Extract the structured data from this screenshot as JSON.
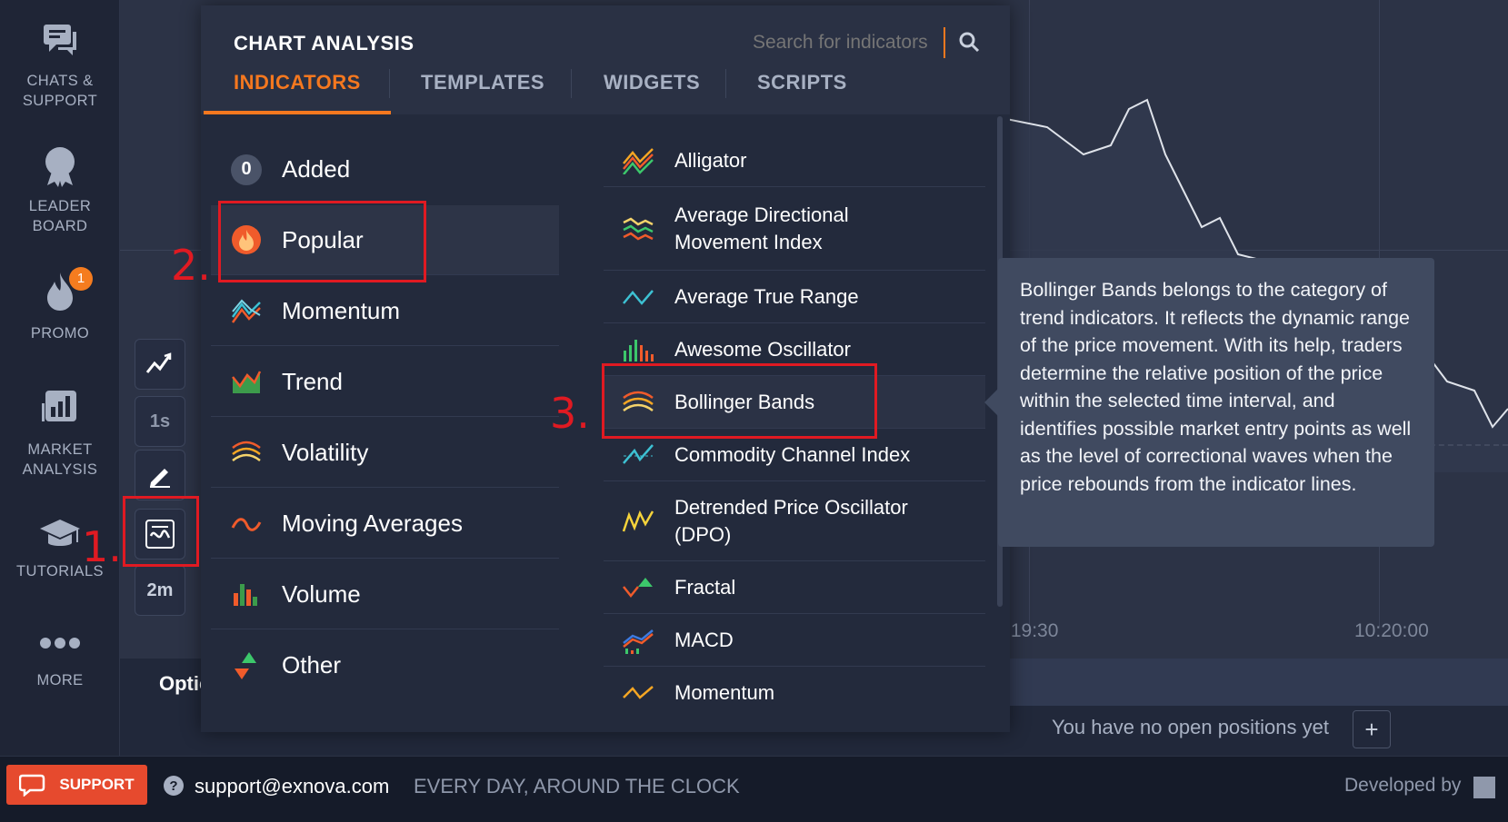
{
  "sidebar": {
    "items": [
      {
        "label": "CHATS &\nSUPPORT",
        "icon": "chat-icon"
      },
      {
        "label": "LEADER\nBOARD",
        "icon": "medal-icon"
      },
      {
        "label": "PROMO",
        "icon": "flame-icon",
        "badge": "1"
      },
      {
        "label": "MARKET\nANALYSIS",
        "icon": "bar-chart-icon"
      },
      {
        "label": "TUTORIALS",
        "icon": "graduation-cap-icon"
      },
      {
        "label": "MORE",
        "icon": "more-dots-icon"
      }
    ]
  },
  "chart": {
    "time_labels": [
      ":19:30",
      "10:20:00"
    ],
    "timeframe": "1s",
    "expiry": "2m",
    "options_tab": "Optic",
    "no_positions": "You have no open positions yet",
    "add_label": "+"
  },
  "annotations": {
    "step1": "1.",
    "step2": "2.",
    "step3": "3."
  },
  "panel": {
    "title": "CHART ANALYSIS",
    "search_placeholder": "Search for indicators",
    "tabs": [
      {
        "label": "INDICATORS",
        "active": true
      },
      {
        "label": "TEMPLATES",
        "active": false
      },
      {
        "label": "WIDGETS",
        "active": false
      },
      {
        "label": "SCRIPTS",
        "active": false
      }
    ],
    "added": {
      "count": "0",
      "label": "Added"
    },
    "categories": [
      {
        "label": "Popular",
        "icon": "fire-icon",
        "active": true
      },
      {
        "label": "Momentum",
        "icon": "momentum-icon"
      },
      {
        "label": "Trend",
        "icon": "trend-icon"
      },
      {
        "label": "Volatility",
        "icon": "volatility-icon"
      },
      {
        "label": "Moving Averages",
        "icon": "moving-average-icon"
      },
      {
        "label": "Volume",
        "icon": "volume-icon"
      },
      {
        "label": "Other",
        "icon": "other-arrows-icon"
      }
    ],
    "indicators": [
      {
        "label": "Alligator",
        "icon": "alligator-icon"
      },
      {
        "label": "Average Directional\nMovement Index",
        "icon": "adx-icon"
      },
      {
        "label": "Average True Range",
        "icon": "atr-icon"
      },
      {
        "label": "Awesome Oscillator",
        "icon": "awesome-oscillator-icon"
      },
      {
        "label": "Bollinger Bands",
        "icon": "bollinger-icon",
        "active": true
      },
      {
        "label": "Commodity Channel Index",
        "icon": "cci-icon"
      },
      {
        "label": "Detrended Price Oscillator\n(DPO)",
        "icon": "dpo-icon"
      },
      {
        "label": "Fractal",
        "icon": "fractal-icon"
      },
      {
        "label": "MACD",
        "icon": "macd-icon"
      },
      {
        "label": "Momentum",
        "icon": "momentum-line-icon"
      }
    ]
  },
  "tooltip": {
    "text": "Bollinger Bands belongs to the category of trend indicators. It reflects the dynamic range of the price movement. With its help, traders determine the relative position of the price within the selected time interval, and identifies possible market entry points as well as the level of correctional waves when the price rebounds from the indicator lines."
  },
  "footer": {
    "support_label": "SUPPORT",
    "email": "support@exnova.com",
    "hours": "EVERY DAY, AROUND THE CLOCK",
    "developed_by": "Developed by"
  },
  "colors": {
    "accent": "#f5781f",
    "annotation_red": "#e01a22",
    "support_button": "#e64a2e",
    "panel_bg": "#232a3c",
    "sidebar_bg": "#1f2536"
  }
}
